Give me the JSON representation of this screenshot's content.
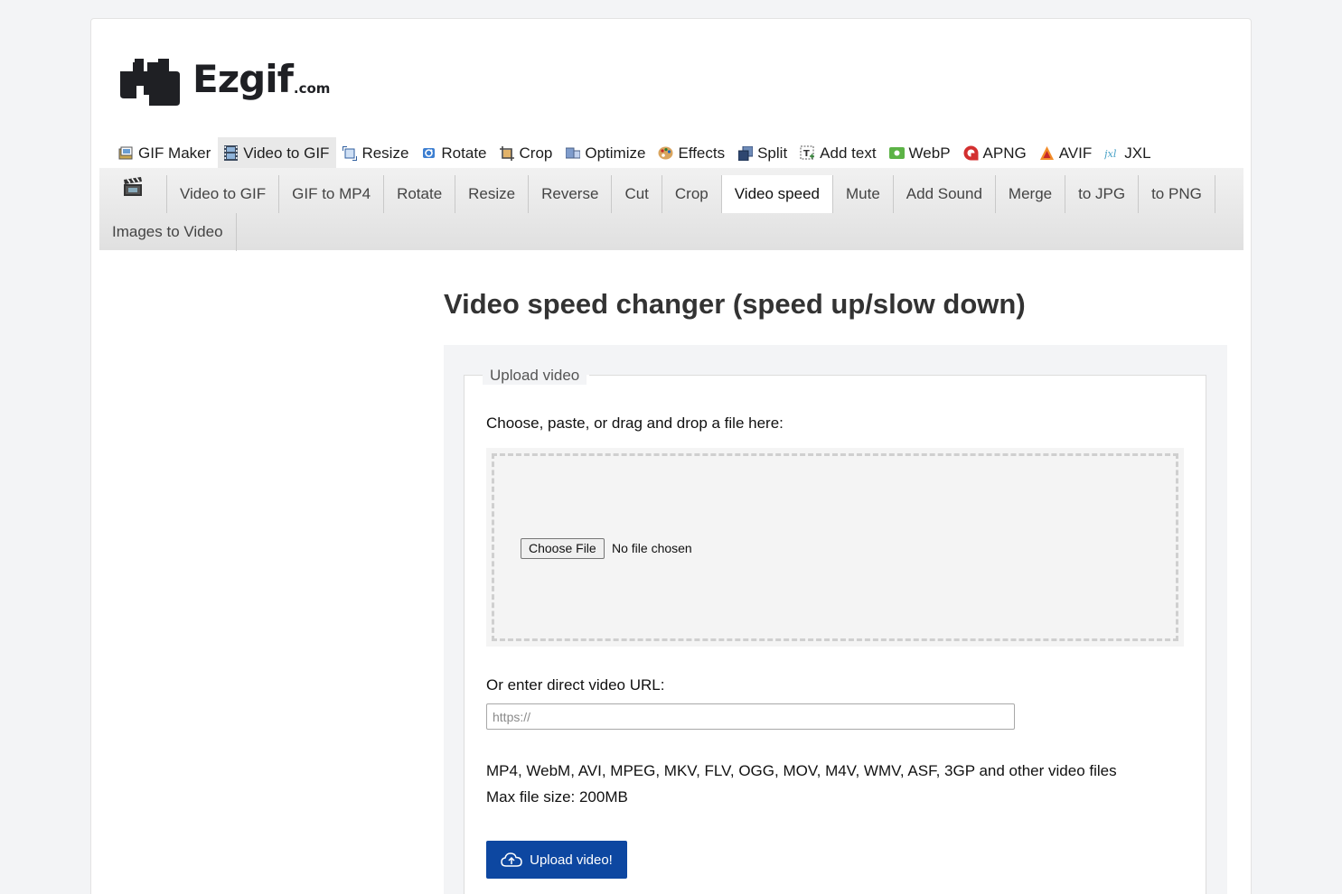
{
  "brand": {
    "name": "Ezgif",
    "suffix": ".com"
  },
  "main_nav": [
    {
      "label": "GIF Maker",
      "icon": "gif-maker-icon"
    },
    {
      "label": "Video to GIF",
      "icon": "film-icon",
      "active": true
    },
    {
      "label": "Resize",
      "icon": "resize-icon"
    },
    {
      "label": "Rotate",
      "icon": "rotate-icon"
    },
    {
      "label": "Crop",
      "icon": "crop-icon"
    },
    {
      "label": "Optimize",
      "icon": "optimize-icon"
    },
    {
      "label": "Effects",
      "icon": "palette-icon"
    },
    {
      "label": "Split",
      "icon": "split-icon"
    },
    {
      "label": "Add text",
      "icon": "add-text-icon"
    },
    {
      "label": "WebP",
      "icon": "webp-icon"
    },
    {
      "label": "APNG",
      "icon": "apng-icon"
    },
    {
      "label": "AVIF",
      "icon": "avif-icon"
    },
    {
      "label": "JXL",
      "icon": "jxl-icon"
    }
  ],
  "sub_nav": {
    "icon": "clapperboard-icon",
    "items": [
      "Video to GIF",
      "GIF to MP4",
      "Rotate",
      "Resize",
      "Reverse",
      "Cut",
      "Crop",
      "Video speed",
      "Mute",
      "Add Sound",
      "Merge",
      "to JPG",
      "to PNG"
    ],
    "row2": [
      "Images to Video"
    ],
    "active": "Video speed"
  },
  "page_title": "Video speed changer (speed up/slow down)",
  "upload": {
    "legend": "Upload video",
    "choose_label": "Choose, paste, or drag and drop a file here:",
    "file_button": "Choose File",
    "file_status": "No file chosen",
    "url_label": "Or enter direct video URL:",
    "url_placeholder": "https://",
    "url_value": "",
    "formats": "MP4, WebM, AVI, MPEG, MKV, FLV, OGG, MOV, M4V, WMV, ASF, 3GP and other video files",
    "max_size": "Max file size: 200MB",
    "button": "Upload video!",
    "button_icon": "cloud-upload-icon"
  },
  "colors": {
    "accent": "#0d47a1",
    "active_tab_bg": "#e9e9e9"
  }
}
